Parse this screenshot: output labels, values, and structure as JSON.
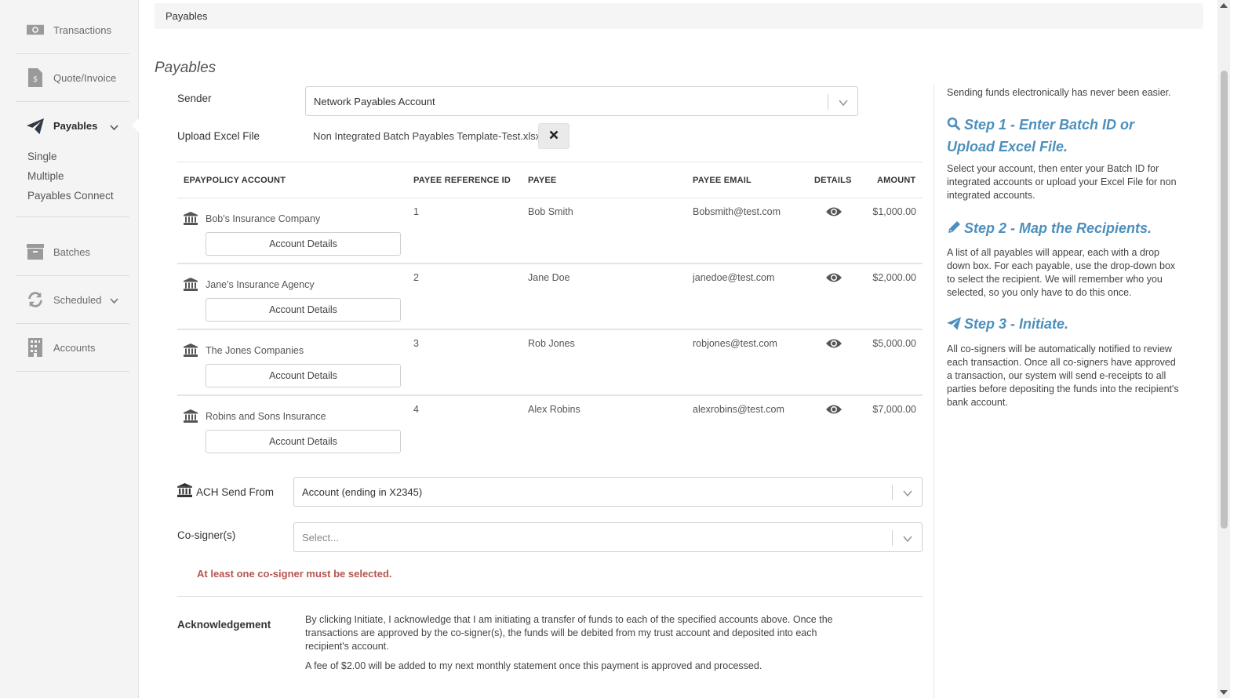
{
  "sidebar": {
    "items": [
      {
        "label": "Transactions",
        "icon": "money-icon"
      },
      {
        "label": "Quote/Invoice",
        "icon": "invoice-icon"
      },
      {
        "label": "Payables",
        "icon": "paper-plane-icon"
      },
      {
        "label": "Batches",
        "icon": "archive-icon"
      },
      {
        "label": "Scheduled",
        "icon": "refresh-icon"
      },
      {
        "label": "Accounts",
        "icon": "building-icon"
      }
    ],
    "payables_sub": [
      "Single",
      "Multiple",
      "Payables Connect"
    ]
  },
  "breadcrumb": "Payables",
  "page_title": "Payables",
  "form": {
    "sender_label": "Sender",
    "sender_value": "Network Payables Account",
    "upload_label": "Upload Excel File",
    "file_name": "Non Integrated Batch Payables Template-Test.xlsx",
    "ach_label": "ACH Send From",
    "ach_value": "Account (ending in X2345)",
    "cosigner_label": "Co-signer(s)",
    "cosigner_placeholder": "Select...",
    "error": "At least one co-signer must be selected.",
    "ack_label": "Acknowledgement",
    "ack_text": "By clicking Initiate, I acknowledge that I am initiating a transfer of funds to each of the specified accounts above. Once the transactions are approved by the co-signer(s), the funds will be debited from my trust account and deposited into each recipient's account.",
    "ack_fee": "A fee of $2.00 will be added to my next monthly statement once this payment is approved and processed."
  },
  "table": {
    "headers": [
      "EPAYPOLICY ACCOUNT",
      "PAYEE REFERENCE ID",
      "PAYEE",
      "PAYEE EMAIL",
      "DETAILS",
      "AMOUNT"
    ],
    "account_details_label": "Account Details",
    "rows": [
      {
        "account": "Bob's Insurance Company",
        "ref": "1",
        "payee": "Bob Smith",
        "email": "Bobsmith@test.com",
        "amount": "$1,000.00"
      },
      {
        "account": "Jane's Insurance Agency",
        "ref": "2",
        "payee": "Jane Doe",
        "email": "janedoe@test.com",
        "amount": "$2,000.00"
      },
      {
        "account": "The Jones Companies",
        "ref": "3",
        "payee": "Rob Jones",
        "email": "robjones@test.com",
        "amount": "$5,000.00"
      },
      {
        "account": "Robins and Sons Insurance",
        "ref": "4",
        "payee": "Alex Robins",
        "email": "alexrobins@test.com",
        "amount": "$7,000.00"
      }
    ]
  },
  "help": {
    "intro": "Sending funds electronically has never been easier.",
    "steps": [
      {
        "title": "Step 1 - Enter Batch ID or Upload Excel File.",
        "text": "Select your account, then enter your Batch ID for integrated accounts or upload your Excel File for non integrated accounts."
      },
      {
        "title": "Step 2 - Map the Recipients.",
        "text": "A list of all payables will appear, each with a drop down box. For each payable, use the drop-down box to select the recipient. We will remember who you selected, so you only have to do this once."
      },
      {
        "title": "Step 3 - Initiate.",
        "text": "All co-signers will be automatically notified to review each transaction. Once all co-signers have approved a transaction, our system will send e-receipts to all parties before depositing the funds into the recipient's bank account."
      }
    ]
  },
  "colors": {
    "accent": "#4d8fbd",
    "error": "#b5564f",
    "sidebar_bg": "#f4f4f4",
    "icon_gray": "#8a8a8a"
  }
}
